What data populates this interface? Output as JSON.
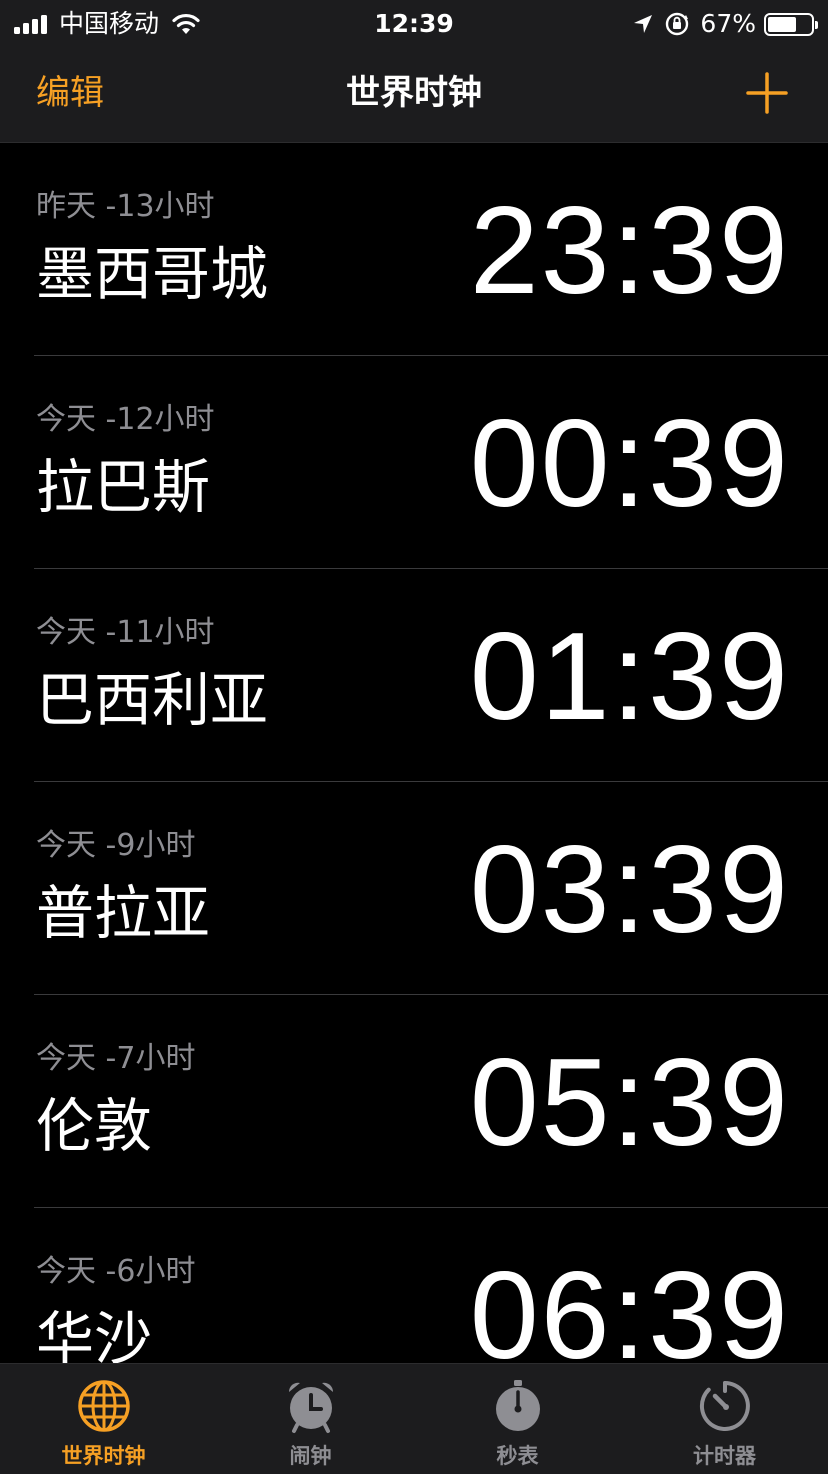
{
  "status_bar": {
    "carrier": "中国移动",
    "time": "12:39",
    "battery_percent": "67%",
    "battery_level": 0.67
  },
  "nav": {
    "edit_label": "编辑",
    "title": "世界时钟",
    "add_icon": "plus-icon"
  },
  "clocks": [
    {
      "offset": "昨天 -13小时",
      "city": "墨西哥城",
      "time": "23:39"
    },
    {
      "offset": "今天 -12小时",
      "city": "拉巴斯",
      "time": "00:39"
    },
    {
      "offset": "今天 -11小时",
      "city": "巴西利亚",
      "time": "01:39"
    },
    {
      "offset": "今天 -9小时",
      "city": "普拉亚",
      "time": "03:39"
    },
    {
      "offset": "今天 -7小时",
      "city": "伦敦",
      "time": "05:39"
    },
    {
      "offset": "今天 -6小时",
      "city": "华沙",
      "time": "06:39"
    }
  ],
  "tabs": [
    {
      "label": "世界时钟",
      "icon": "globe-icon",
      "active": true
    },
    {
      "label": "闹钟",
      "icon": "alarm-clock-icon",
      "active": false
    },
    {
      "label": "秒表",
      "icon": "stopwatch-icon",
      "active": false
    },
    {
      "label": "计时器",
      "icon": "timer-icon",
      "active": false
    }
  ],
  "colors": {
    "accent": "#f6a024",
    "inactive": "#8e8e93",
    "background": "#000000",
    "bar_background": "#1c1c1e"
  }
}
